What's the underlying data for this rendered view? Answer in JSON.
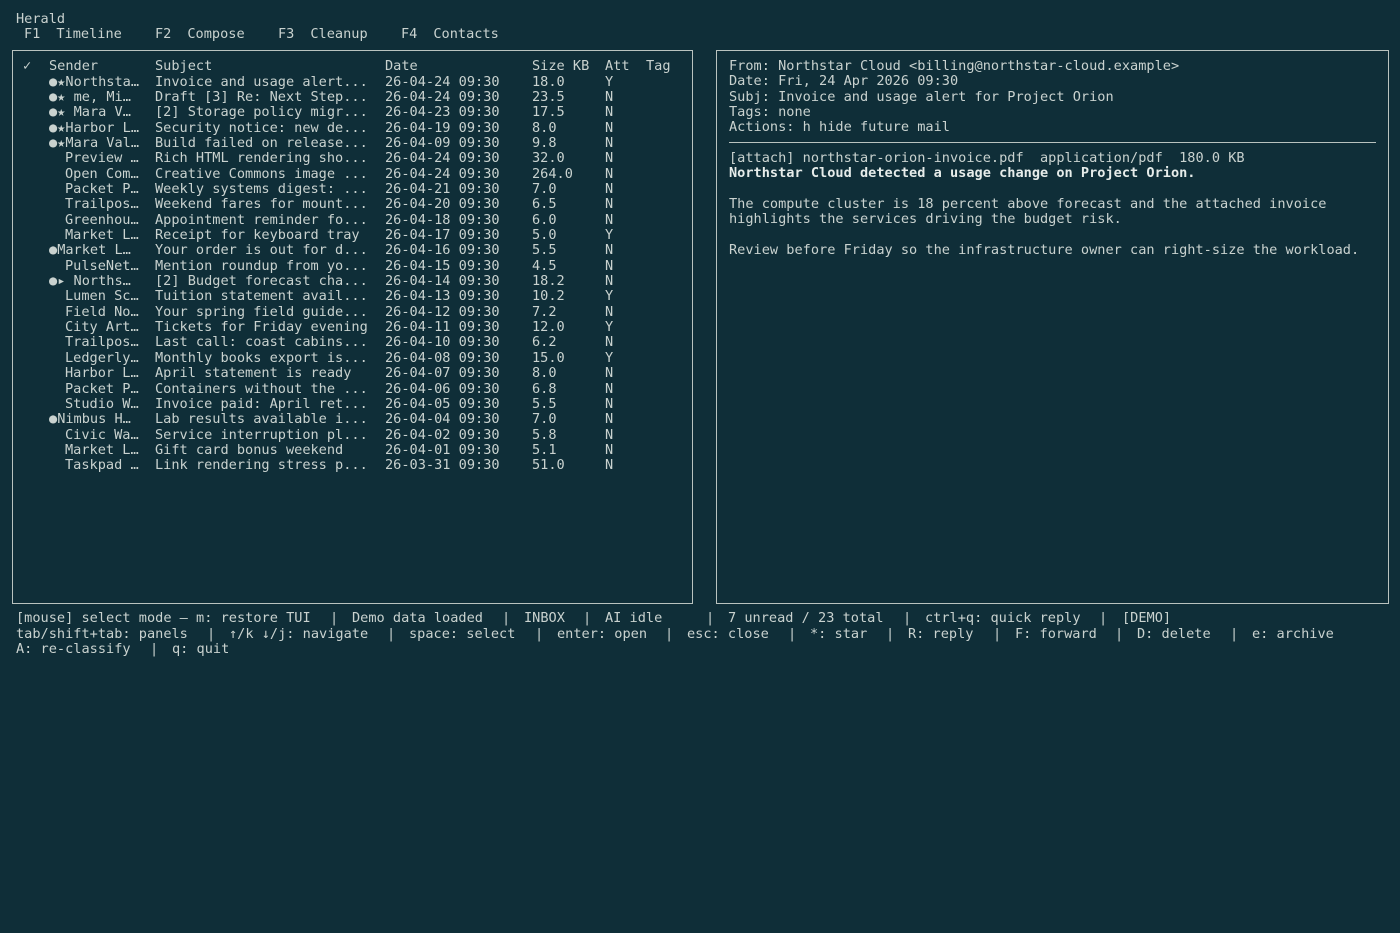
{
  "app": {
    "title": "Herald"
  },
  "tabs": [
    {
      "key": "F1",
      "label": "Timeline"
    },
    {
      "key": "F2",
      "label": "Compose"
    },
    {
      "key": "F3",
      "label": "Cleanup"
    },
    {
      "key": "F4",
      "label": "Contacts"
    }
  ],
  "list": {
    "headers": {
      "check": "✓",
      "sender": "Sender",
      "subject": "Subject",
      "date": "Date",
      "size": "Size KB",
      "att": "Att",
      "tag": "Tag"
    },
    "rows": [
      {
        "flags": "●★",
        "sender": "Northsta…",
        "subject": "Invoice and usage alert...",
        "date": "26-04-24 09:30",
        "size": "18.0",
        "att": "Y"
      },
      {
        "flags": "●★▸",
        "sender": "me, Mi…",
        "subject": "Draft [3] Re: Next Step...",
        "date": "26-04-24 09:30",
        "size": "23.5",
        "att": "N"
      },
      {
        "flags": "●★▸",
        "sender": "Mara V…",
        "subject": "[2] Storage policy migr...",
        "date": "26-04-23 09:30",
        "size": "17.5",
        "att": "N"
      },
      {
        "flags": "●★",
        "sender": "Harbor L…",
        "subject": "Security notice: new de...",
        "date": "26-04-19 09:30",
        "size": "8.0",
        "att": "N"
      },
      {
        "flags": "●★",
        "sender": "Mara Val…",
        "subject": "Build failed on release...",
        "date": "26-04-09 09:30",
        "size": "9.8",
        "att": "N"
      },
      {
        "flags": "",
        "sender": "Preview …",
        "subject": "Rich HTML rendering sho...",
        "date": "26-04-24 09:30",
        "size": "32.0",
        "att": "N"
      },
      {
        "flags": "",
        "sender": "Open Com…",
        "subject": "Creative Commons image ...",
        "date": "26-04-24 09:30",
        "size": "264.0",
        "att": "N"
      },
      {
        "flags": "",
        "sender": "Packet P…",
        "subject": "Weekly systems digest: ...",
        "date": "26-04-21 09:30",
        "size": "7.0",
        "att": "N"
      },
      {
        "flags": "",
        "sender": "Trailpos…",
        "subject": "Weekend fares for mount...",
        "date": "26-04-20 09:30",
        "size": "6.5",
        "att": "N"
      },
      {
        "flags": "",
        "sender": "Greenhou…",
        "subject": "Appointment reminder fo...",
        "date": "26-04-18 09:30",
        "size": "6.0",
        "att": "N"
      },
      {
        "flags": "",
        "sender": "Market L…",
        "subject": "Receipt for keyboard tray",
        "date": "26-04-17 09:30",
        "size": "5.0",
        "att": "Y"
      },
      {
        "flags": "●",
        "sender": "Market L…",
        "subject": "Your order is out for d...",
        "date": "26-04-16 09:30",
        "size": "5.5",
        "att": "N"
      },
      {
        "flags": "",
        "sender": "PulseNet…",
        "subject": "Mention roundup from yo...",
        "date": "26-04-15 09:30",
        "size": "4.5",
        "att": "N"
      },
      {
        "flags": "●",
        "sender": "▸ Norths…",
        "subject": "[2] Budget forecast cha...",
        "date": "26-04-14 09:30",
        "size": "18.2",
        "att": "N"
      },
      {
        "flags": "",
        "sender": "Lumen Sc…",
        "subject": "Tuition statement avail...",
        "date": "26-04-13 09:30",
        "size": "10.2",
        "att": "Y"
      },
      {
        "flags": "",
        "sender": "Field No…",
        "subject": "Your spring field guide...",
        "date": "26-04-12 09:30",
        "size": "7.2",
        "att": "N"
      },
      {
        "flags": "",
        "sender": "City Art…",
        "subject": "Tickets for Friday evening",
        "date": "26-04-11 09:30",
        "size": "12.0",
        "att": "Y"
      },
      {
        "flags": "",
        "sender": "Trailpos…",
        "subject": "Last call: coast cabins...",
        "date": "26-04-10 09:30",
        "size": "6.2",
        "att": "N"
      },
      {
        "flags": "",
        "sender": "Ledgerly…",
        "subject": "Monthly books export is...",
        "date": "26-04-08 09:30",
        "size": "15.0",
        "att": "Y"
      },
      {
        "flags": "",
        "sender": "Harbor L…",
        "subject": "April statement is ready",
        "date": "26-04-07 09:30",
        "size": "8.0",
        "att": "N"
      },
      {
        "flags": "",
        "sender": "Packet P…",
        "subject": "Containers without the ...",
        "date": "26-04-06 09:30",
        "size": "6.8",
        "att": "N"
      },
      {
        "flags": "",
        "sender": "Studio W…",
        "subject": "Invoice paid: April ret...",
        "date": "26-04-05 09:30",
        "size": "5.5",
        "att": "N"
      },
      {
        "flags": "●",
        "sender": "Nimbus H…",
        "subject": "Lab results available i...",
        "date": "26-04-04 09:30",
        "size": "7.0",
        "att": "N"
      },
      {
        "flags": "",
        "sender": "Civic Wa…",
        "subject": "Service interruption pl...",
        "date": "26-04-02 09:30",
        "size": "5.8",
        "att": "N"
      },
      {
        "flags": "",
        "sender": "Market L…",
        "subject": "Gift card bonus weekend",
        "date": "26-04-01 09:30",
        "size": "5.1",
        "att": "N"
      },
      {
        "flags": "",
        "sender": "Taskpad …",
        "subject": "Link rendering stress p...",
        "date": "26-03-31 09:30",
        "size": "51.0",
        "att": "N"
      }
    ]
  },
  "reader": {
    "from": "From: Northstar Cloud <billing@northstar-cloud.example>",
    "date": "Date: Fri, 24 Apr 2026 09:30",
    "subject": "Subj: Invoice and usage alert for Project Orion",
    "tags": "Tags: none",
    "actions": "Actions: h hide future mail",
    "attachment": "[attach] northstar-orion-invoice.pdf  application/pdf  180.0 KB",
    "body": [
      "Northstar Cloud detected a usage change on Project Orion.",
      "The compute cluster is 18 percent above forecast and the attached invoice",
      "highlights the services driving the budget risk.",
      "Review before Friday so the infrastructure owner can right-size the workload."
    ]
  },
  "status": {
    "mode": "[mouse] select mode — m: restore TUI",
    "data": "Demo data loaded",
    "folder": "INBOX",
    "ai": "AI idle",
    "counts": "7 unread / 23 total",
    "quick_reply": "ctrl+q: quick reply",
    "demo": "[DEMO]"
  },
  "keys": {
    "line1": [
      "tab/shift+tab: panels",
      "↑/k ↓/j: navigate",
      "space: select",
      "enter: open",
      "esc: close",
      "*: star",
      "R: reply",
      "F: forward",
      "D: delete",
      "e: archive"
    ],
    "line2": [
      "A: re-classify",
      "q: quit"
    ]
  },
  "colors": {
    "background": "#0f2e38",
    "text": "#c9d2cf",
    "border": "#b9c3bf"
  }
}
